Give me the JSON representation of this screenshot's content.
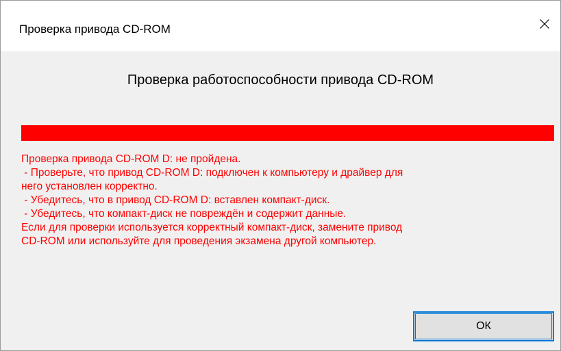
{
  "window": {
    "title": "Проверка привода CD-ROM",
    "close_icon": "close-icon"
  },
  "dialog": {
    "heading": "Проверка работоспособности привода CD-ROM",
    "progress": {
      "fraction": 1.0,
      "color": "#ff0000"
    },
    "message": {
      "color": "#ff0000",
      "lines": [
        "Проверка привода CD-ROM D: не пройдена.",
        " - Проверьте, что привод CD-ROM D: подключен к компьютеру и драйвер для",
        "него установлен корректно.",
        " - Убедитесь, что в привод CD-ROM D: вставлен компакт-диск.",
        " - Убедитесь, что компакт-диск не повреждён и содержит данные.",
        "Если для проверки используется корректный компакт-диск, замените привод",
        "CD-ROM или используйте для проведения экзамена другой компьютер."
      ]
    },
    "ok_label": "ОК"
  }
}
